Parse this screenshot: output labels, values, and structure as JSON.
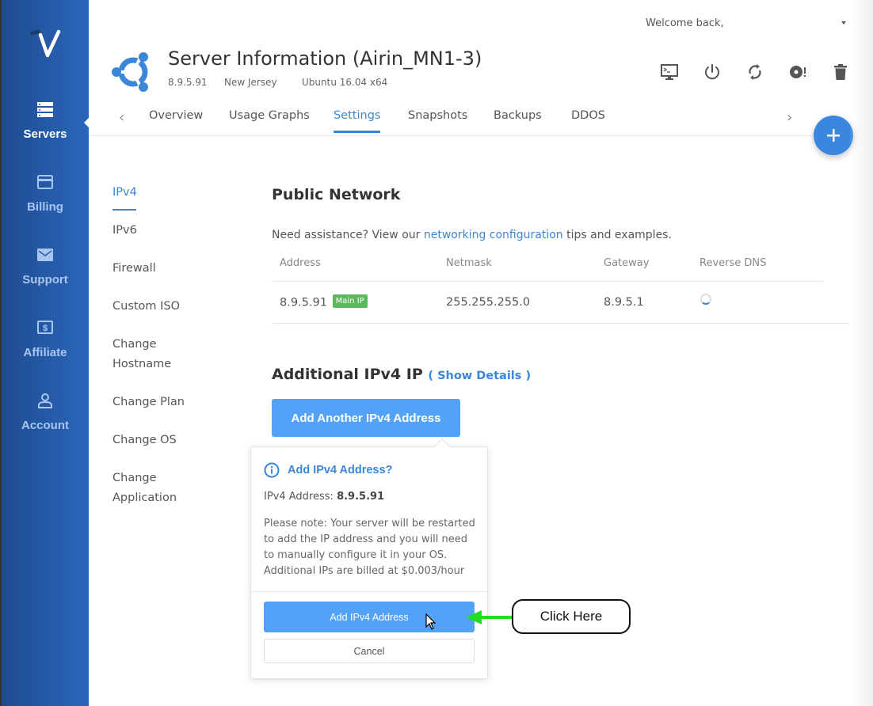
{
  "sidebar": {
    "logo": "vultr-logo-icon",
    "items": [
      {
        "label": "Servers",
        "icon": "server-stack-icon",
        "active": true
      },
      {
        "label": "Billing",
        "icon": "credit-card-icon",
        "active": false
      },
      {
        "label": "Support",
        "icon": "envelope-icon",
        "active": false
      },
      {
        "label": "Affiliate",
        "icon": "dollar-bill-icon",
        "active": false
      },
      {
        "label": "Account",
        "icon": "user-icon",
        "active": false
      }
    ]
  },
  "header": {
    "welcome": "Welcome back,",
    "title": "Server Information (Airin_MN1-3)",
    "ip": "8.9.5.91",
    "location": "New Jersey",
    "os": "Ubuntu 16.04 x64",
    "actions": [
      {
        "name": "console",
        "icon": "console-icon"
      },
      {
        "name": "power",
        "icon": "power-icon"
      },
      {
        "name": "restart",
        "icon": "restart-icon"
      },
      {
        "name": "reinstall",
        "icon": "disc-alert-icon"
      },
      {
        "name": "destroy",
        "icon": "trash-icon"
      }
    ]
  },
  "tabs": [
    {
      "label": "Overview",
      "active": false
    },
    {
      "label": "Usage Graphs",
      "active": false
    },
    {
      "label": "Settings",
      "active": true
    },
    {
      "label": "Snapshots",
      "active": false
    },
    {
      "label": "Backups",
      "active": false
    },
    {
      "label": "DDOS",
      "active": false
    }
  ],
  "settings_menu": [
    {
      "label": "IPv4",
      "active": true
    },
    {
      "label": "IPv6"
    },
    {
      "label": "Firewall"
    },
    {
      "label": "Custom ISO"
    },
    {
      "label": "Change Hostname",
      "line1": "Change",
      "line2": "Hostname"
    },
    {
      "label": "Change Plan"
    },
    {
      "label": "Change OS"
    },
    {
      "label": "Change Application",
      "line1": "Change",
      "line2": "Application"
    }
  ],
  "public_network": {
    "title": "Public Network",
    "assist_prefix": "Need assistance? View our ",
    "assist_link": "networking configuration",
    "assist_suffix": " tips and examples.",
    "columns": [
      "Address",
      "Netmask",
      "Gateway",
      "Reverse DNS"
    ],
    "rows": [
      {
        "address": "8.9.5.91",
        "badge": "Main IP",
        "netmask": "255.255.255.0",
        "gateway": "8.9.5.1",
        "reverse_dns": "loading"
      }
    ]
  },
  "additional": {
    "title": "Additional IPv4 IP",
    "show_details": "( Show Details )",
    "add_button": "Add Another IPv4 Address"
  },
  "popover": {
    "title": "Add IPv4 Address?",
    "ip_label": "IPv4 Address: ",
    "ip_value": "8.9.5.91",
    "note": "Please note: Your server will be restarted to add the IP address and you will need to manually configure it in your OS. Additional IPs are billed at $0.003/hour",
    "confirm": "Add IPv4 Address",
    "cancel": "Cancel"
  },
  "annotation": {
    "text": "Click Here",
    "arrow_color": "#22dd22"
  },
  "colors": {
    "accent": "#3b86d7",
    "button": "#52a2f7",
    "sidebar_start": "#1f4c90",
    "sidebar_end": "#2a66bb",
    "badge": "#5cb85c",
    "fab": "#3a87e0"
  }
}
